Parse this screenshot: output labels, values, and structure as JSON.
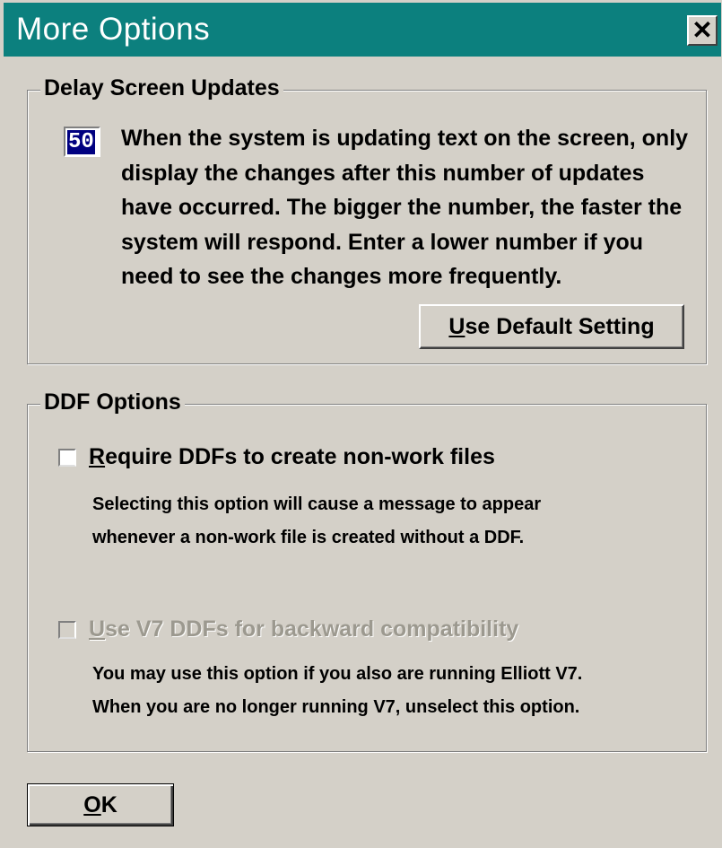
{
  "window": {
    "title": "More Options",
    "close_glyph": "✕"
  },
  "delay_group": {
    "legend": "Delay Screen Updates",
    "value": "50",
    "description": "When the system is updating text on the screen, only display the changes after this number of updates have occurred.  The bigger the number, the faster the system will respond.  Enter a lower number if you need to see the changes more frequently.",
    "default_button": {
      "mnemonic": "U",
      "label_rest": "se Default Setting"
    }
  },
  "ddf_group": {
    "legend": "DDF Options",
    "require_ddfs": {
      "checked": false,
      "mnemonic": "R",
      "label_rest": "equire DDFs to create non-work files",
      "help_line1": "Selecting this option will cause a message to appear",
      "help_line2": "whenever a non-work file is created without a DDF."
    },
    "use_v7": {
      "checked": false,
      "disabled": true,
      "mnemonic": "U",
      "label_rest": "se V7 DDFs for backward compatibility",
      "help_line1": "You may use this option if you also are running Elliott V7.",
      "help_line2": "When you are no longer running V7, unselect this option."
    }
  },
  "footer": {
    "ok": {
      "mnemonic": "O",
      "label_rest": "K"
    }
  },
  "colors": {
    "titlebar": "#0c807e",
    "face": "#d4d0c8",
    "selection": "#000080",
    "disabled_text": "#9c998f"
  }
}
